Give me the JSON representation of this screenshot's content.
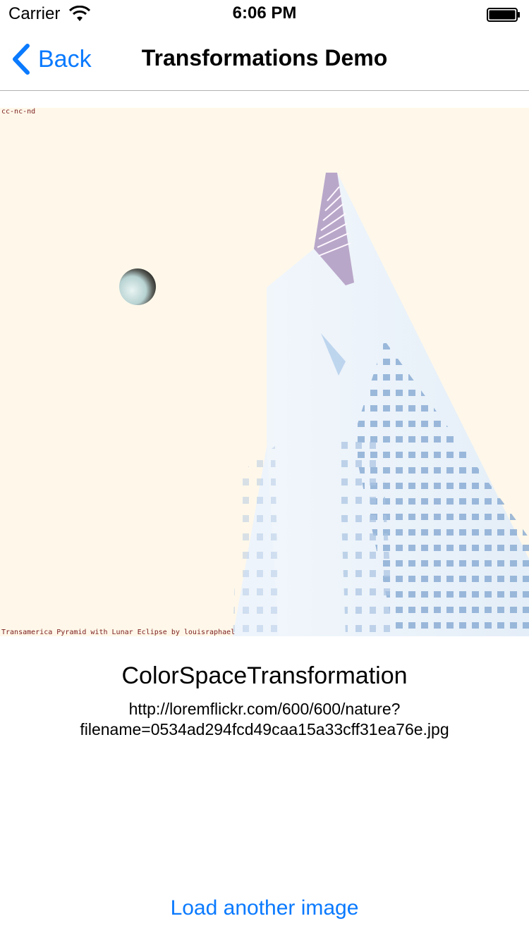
{
  "status_bar": {
    "carrier": "Carrier",
    "time": "6:06 PM",
    "wifi_icon": "wifi-icon",
    "battery_icon": "battery-icon"
  },
  "nav": {
    "back_label": "Back",
    "back_icon": "chevron-left-icon",
    "title": "Transformations Demo"
  },
  "image": {
    "license": "cc-nc-nd",
    "caption": "Transamerica Pyramid with Lunar Eclipse by louisraphael"
  },
  "transformation_name": "ColorSpaceTransformation",
  "image_url_line1": "http://loremflickr.com/600/600/nature?",
  "image_url_line2": "filename=0534ad294fcd49caa15a33cff31ea76e.jpg",
  "load_button_label": "Load another image",
  "colors": {
    "accent": "#0a7aff",
    "image_background": "#fff8ea",
    "separator": "#b2b2b2"
  }
}
